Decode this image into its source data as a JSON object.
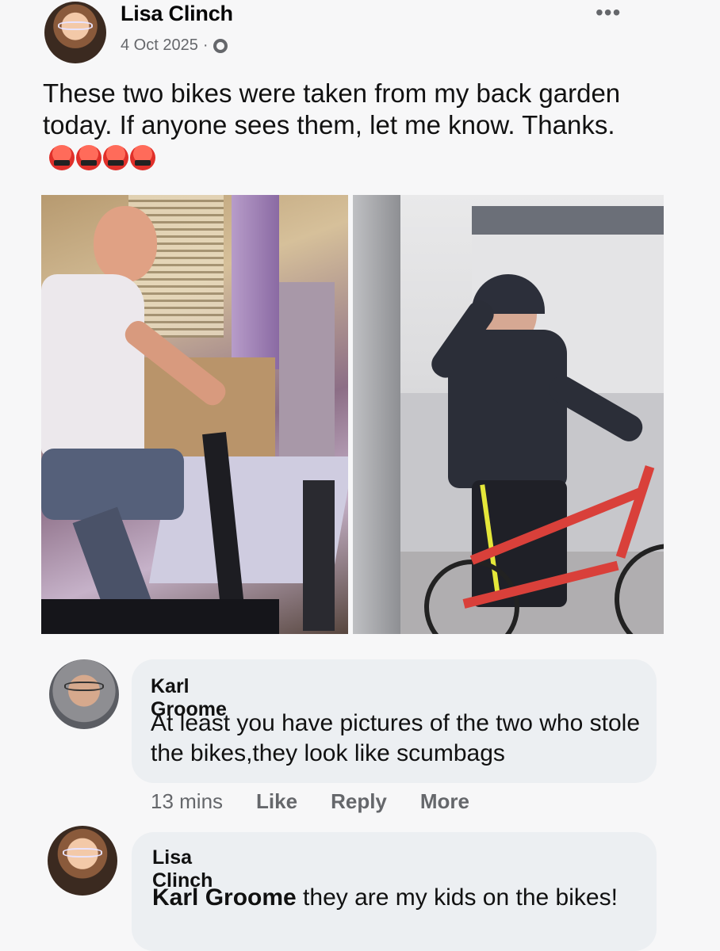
{
  "post": {
    "author": "Lisa Clinch",
    "date": "4 Oct 2025",
    "separator": "·",
    "privacy_icon": "globe-icon",
    "menu_icon": "more-horizontal-icon",
    "menu_glyph": "•••",
    "text": "These two bikes were taken from my back garden today. If anyone sees them, let me know. Thanks.",
    "emojis": [
      "angry-face-icon",
      "angry-face-icon",
      "angry-face-icon",
      "angry-face-icon"
    ]
  },
  "comments": [
    {
      "author": "Karl Groome",
      "text": "At least you have pictures of the two who stole the bikes,they look like scumbags",
      "time": "13 mins",
      "actions": [
        "Like",
        "Reply",
        "More"
      ]
    },
    {
      "author": "Lisa Clinch",
      "mention": "Karl Groome",
      "text": " they are my kids on the bikes!"
    }
  ],
  "colors": {
    "background": "#f7f7f8",
    "bubble": "#eceff2",
    "secondary_text": "#65676b",
    "bike_red": "#d9403a"
  }
}
